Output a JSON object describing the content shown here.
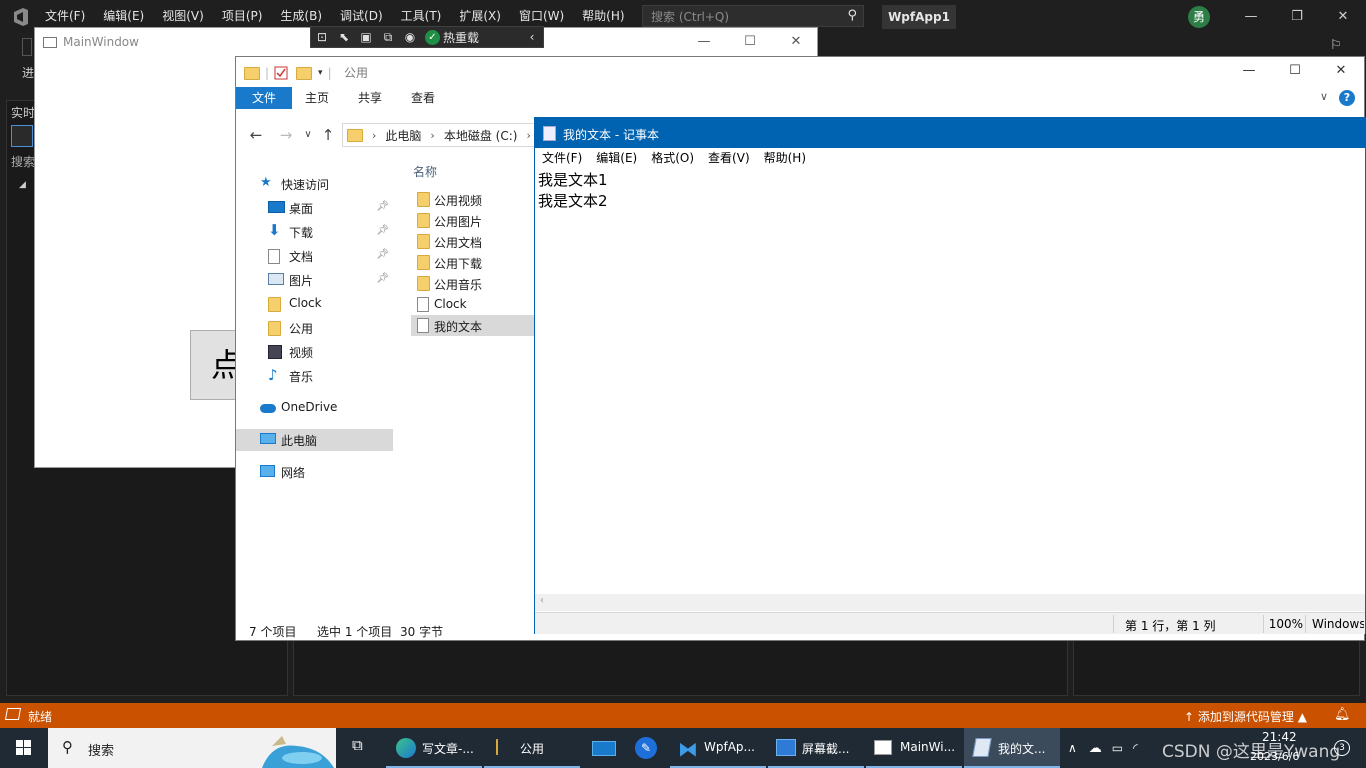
{
  "vs": {
    "menu": [
      "文件(F)",
      "编辑(E)",
      "视图(V)",
      "项目(P)",
      "生成(B)",
      "调试(D)",
      "工具(T)",
      "扩展(X)",
      "窗口(W)",
      "帮助(H)"
    ],
    "search_placeholder": "搜索 (Ctrl+Q)",
    "project_name": "WpfApp1",
    "user_initial": "勇",
    "left_panel_tab": "实时",
    "left_panel_search": "搜索",
    "toolbar_label": "进",
    "hot_reload_label": "热重载",
    "status_text": "就绪",
    "status_source_control": "添加到源代码管理",
    "accent_color": "#ca5100"
  },
  "mainwindow": {
    "title": "MainWindow",
    "button_text": "点"
  },
  "explorer": {
    "title": "公用",
    "ribbon_tabs": [
      "文件",
      "主页",
      "共享",
      "查看"
    ],
    "address": [
      "此电脑",
      "本地磁盘 (C:)"
    ],
    "nav_items": [
      {
        "label": "快速访问",
        "icon": "star-icon"
      },
      {
        "label": "桌面",
        "icon": "desktop-icon",
        "pinned": true
      },
      {
        "label": "下载",
        "icon": "download-icon",
        "pinned": true
      },
      {
        "label": "文档",
        "icon": "document-icon",
        "pinned": true
      },
      {
        "label": "图片",
        "icon": "picture-icon",
        "pinned": true
      },
      {
        "label": "Clock",
        "icon": "folder-icon"
      },
      {
        "label": "公用",
        "icon": "folder-icon"
      },
      {
        "label": "视频",
        "icon": "video-icon"
      },
      {
        "label": "音乐",
        "icon": "music-icon"
      },
      {
        "label": "OneDrive",
        "icon": "cloud-icon"
      },
      {
        "label": "此电脑",
        "icon": "computer-icon"
      },
      {
        "label": "网络",
        "icon": "network-icon"
      }
    ],
    "column_header": "名称",
    "files": [
      {
        "name": "公用视频",
        "type": "folder"
      },
      {
        "name": "公用图片",
        "type": "folder"
      },
      {
        "name": "公用文档",
        "type": "folder"
      },
      {
        "name": "公用下载",
        "type": "folder"
      },
      {
        "name": "公用音乐",
        "type": "folder"
      },
      {
        "name": "Clock",
        "type": "file"
      },
      {
        "name": "我的文本",
        "type": "file"
      }
    ],
    "status_count": "7 个项目",
    "status_selected": "选中 1 个项目",
    "status_size": "30 字节"
  },
  "notepad": {
    "title": "我的文本 - 记事本",
    "menu": [
      "文件(F)",
      "编辑(E)",
      "格式(O)",
      "查看(V)",
      "帮助(H)"
    ],
    "lines": [
      "我是文本1",
      "我是文本2"
    ],
    "status_position": "第 1 行，第 1 列",
    "status_zoom": "100%",
    "status_eol": "Windows (CRLF)"
  },
  "taskbar": {
    "search_text": "搜索",
    "apps": [
      {
        "label": "写文章-...",
        "icon": "edge-icon"
      },
      {
        "label": "公用",
        "icon": "folder-icon"
      },
      {
        "label": "",
        "icon": "mail-icon"
      },
      {
        "label": "",
        "icon": "pin-app-icon"
      },
      {
        "label": "WpfAp...",
        "icon": "visual-studio-icon"
      },
      {
        "label": "屏幕截...",
        "icon": "screenshot-icon"
      },
      {
        "label": "MainWi...",
        "icon": "window-icon"
      },
      {
        "label": "我的文...",
        "icon": "notepad-icon"
      }
    ],
    "time": "21:42",
    "date": "2023/6/6",
    "watermark": "CSDN @这里是Ywang",
    "notification_count": "3"
  }
}
